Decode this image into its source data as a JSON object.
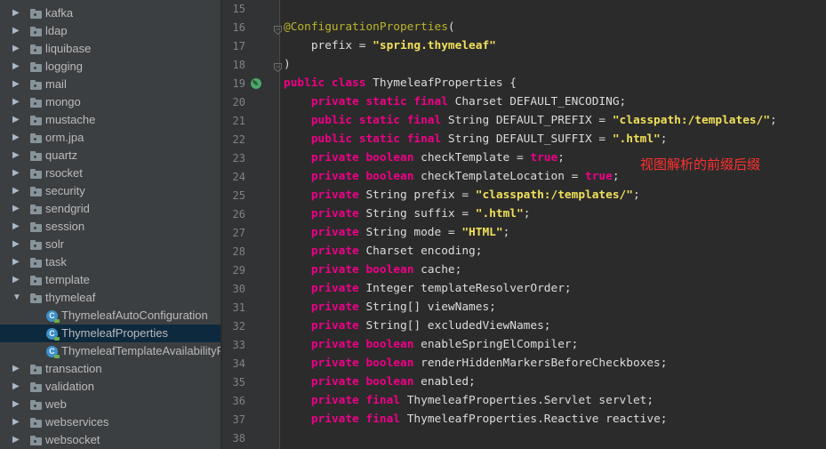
{
  "tree": {
    "items": [
      {
        "label": "kafka",
        "type": "folder",
        "state": "collapsed"
      },
      {
        "label": "ldap",
        "type": "folder",
        "state": "collapsed"
      },
      {
        "label": "liquibase",
        "type": "folder",
        "state": "collapsed"
      },
      {
        "label": "logging",
        "type": "folder",
        "state": "collapsed"
      },
      {
        "label": "mail",
        "type": "folder",
        "state": "collapsed"
      },
      {
        "label": "mongo",
        "type": "folder",
        "state": "collapsed"
      },
      {
        "label": "mustache",
        "type": "folder",
        "state": "collapsed"
      },
      {
        "label": "orm.jpa",
        "type": "folder",
        "state": "collapsed"
      },
      {
        "label": "quartz",
        "type": "folder",
        "state": "collapsed"
      },
      {
        "label": "rsocket",
        "type": "folder",
        "state": "collapsed"
      },
      {
        "label": "security",
        "type": "folder",
        "state": "collapsed"
      },
      {
        "label": "sendgrid",
        "type": "folder",
        "state": "collapsed"
      },
      {
        "label": "session",
        "type": "folder",
        "state": "collapsed"
      },
      {
        "label": "solr",
        "type": "folder",
        "state": "collapsed"
      },
      {
        "label": "task",
        "type": "folder",
        "state": "collapsed"
      },
      {
        "label": "template",
        "type": "folder",
        "state": "collapsed"
      },
      {
        "label": "thymeleaf",
        "type": "folder",
        "state": "expanded"
      },
      {
        "label": "ThymeleafAutoConfiguration",
        "type": "class",
        "state": "leaf"
      },
      {
        "label": "ThymeleafProperties",
        "type": "class",
        "state": "leaf",
        "selected": true
      },
      {
        "label": "ThymeleafTemplateAvailabilityProvider",
        "type": "class",
        "state": "leaf"
      },
      {
        "label": "transaction",
        "type": "folder",
        "state": "collapsed"
      },
      {
        "label": "validation",
        "type": "folder",
        "state": "collapsed"
      },
      {
        "label": "web",
        "type": "folder",
        "state": "collapsed"
      },
      {
        "label": "webservices",
        "type": "folder",
        "state": "collapsed"
      },
      {
        "label": "websocket",
        "type": "folder",
        "state": "collapsed"
      }
    ]
  },
  "editor": {
    "lines": [
      {
        "n": "15",
        "tokens": []
      },
      {
        "n": "16",
        "fold": true,
        "tokens": [
          [
            "ann",
            "@ConfigurationProperties"
          ],
          [
            "plain",
            "("
          ]
        ]
      },
      {
        "n": "17",
        "tokens": [
          [
            "plain",
            "    prefix = "
          ],
          [
            "str",
            "\"spring.thymeleaf\""
          ]
        ]
      },
      {
        "n": "18",
        "fold": true,
        "tokens": [
          [
            "plain",
            ")"
          ]
        ]
      },
      {
        "n": "19",
        "bean": true,
        "tokens": [
          [
            "kw",
            "public class "
          ],
          [
            "plain",
            "ThymeleafProperties {"
          ]
        ]
      },
      {
        "n": "20",
        "tokens": [
          [
            "plain",
            "    "
          ],
          [
            "kw",
            "private static final "
          ],
          [
            "plain",
            "Charset DEFAULT_ENCODING;"
          ]
        ]
      },
      {
        "n": "21",
        "tokens": [
          [
            "plain",
            "    "
          ],
          [
            "kw",
            "public static final "
          ],
          [
            "plain",
            "String DEFAULT_PREFIX = "
          ],
          [
            "str",
            "\"classpath:/templates/\""
          ],
          [
            "plain",
            ";"
          ]
        ]
      },
      {
        "n": "22",
        "tokens": [
          [
            "plain",
            "    "
          ],
          [
            "kw",
            "public static final "
          ],
          [
            "plain",
            "String DEFAULT_SUFFIX = "
          ],
          [
            "str",
            "\".html\""
          ],
          [
            "plain",
            ";"
          ]
        ]
      },
      {
        "n": "23",
        "tokens": [
          [
            "plain",
            "    "
          ],
          [
            "kw",
            "private boolean "
          ],
          [
            "plain",
            "checkTemplate = "
          ],
          [
            "kw",
            "true"
          ],
          [
            "plain",
            ";"
          ]
        ]
      },
      {
        "n": "24",
        "tokens": [
          [
            "plain",
            "    "
          ],
          [
            "kw",
            "private boolean "
          ],
          [
            "plain",
            "checkTemplateLocation = "
          ],
          [
            "kw",
            "true"
          ],
          [
            "plain",
            ";"
          ]
        ]
      },
      {
        "n": "25",
        "tokens": [
          [
            "plain",
            "    "
          ],
          [
            "kw",
            "private "
          ],
          [
            "plain",
            "String prefix = "
          ],
          [
            "str",
            "\"classpath:/templates/\""
          ],
          [
            "plain",
            ";"
          ]
        ]
      },
      {
        "n": "26",
        "tokens": [
          [
            "plain",
            "    "
          ],
          [
            "kw",
            "private "
          ],
          [
            "plain",
            "String suffix = "
          ],
          [
            "str",
            "\".html\""
          ],
          [
            "plain",
            ";"
          ]
        ]
      },
      {
        "n": "27",
        "tokens": [
          [
            "plain",
            "    "
          ],
          [
            "kw",
            "private "
          ],
          [
            "plain",
            "String mode = "
          ],
          [
            "str",
            "\"HTML\""
          ],
          [
            "plain",
            ";"
          ]
        ]
      },
      {
        "n": "28",
        "tokens": [
          [
            "plain",
            "    "
          ],
          [
            "kw",
            "private "
          ],
          [
            "plain",
            "Charset encoding;"
          ]
        ]
      },
      {
        "n": "29",
        "tokens": [
          [
            "plain",
            "    "
          ],
          [
            "kw",
            "private boolean "
          ],
          [
            "plain",
            "cache;"
          ]
        ]
      },
      {
        "n": "30",
        "tokens": [
          [
            "plain",
            "    "
          ],
          [
            "kw",
            "private "
          ],
          [
            "plain",
            "Integer templateResolverOrder;"
          ]
        ]
      },
      {
        "n": "31",
        "tokens": [
          [
            "plain",
            "    "
          ],
          [
            "kw",
            "private "
          ],
          [
            "plain",
            "String[] viewNames;"
          ]
        ]
      },
      {
        "n": "32",
        "tokens": [
          [
            "plain",
            "    "
          ],
          [
            "kw",
            "private "
          ],
          [
            "plain",
            "String[] excludedViewNames;"
          ]
        ]
      },
      {
        "n": "33",
        "tokens": [
          [
            "plain",
            "    "
          ],
          [
            "kw",
            "private boolean "
          ],
          [
            "plain",
            "enableSpringElCompiler;"
          ]
        ]
      },
      {
        "n": "34",
        "tokens": [
          [
            "plain",
            "    "
          ],
          [
            "kw",
            "private boolean "
          ],
          [
            "plain",
            "renderHiddenMarkersBeforeCheckboxes;"
          ]
        ]
      },
      {
        "n": "35",
        "tokens": [
          [
            "plain",
            "    "
          ],
          [
            "kw",
            "private boolean "
          ],
          [
            "plain",
            "enabled;"
          ]
        ]
      },
      {
        "n": "36",
        "tokens": [
          [
            "plain",
            "    "
          ],
          [
            "kw",
            "private final "
          ],
          [
            "plain",
            "ThymeleafProperties."
          ],
          [
            "plain",
            "Servlet servlet;"
          ]
        ]
      },
      {
        "n": "37",
        "tokens": [
          [
            "plain",
            "    "
          ],
          [
            "kw",
            "private final "
          ],
          [
            "plain",
            "ThymeleafProperties."
          ],
          [
            "plain",
            "Reactive reactive;"
          ]
        ]
      },
      {
        "n": "38",
        "tokens": []
      }
    ],
    "annotation_note": "视图解析的前缀后缀"
  },
  "colors": {
    "keyword": "#ee0087",
    "string": "#f1e05a",
    "annotation": "#bbb529",
    "note": "#ff3030",
    "selection": "#0d293e"
  }
}
